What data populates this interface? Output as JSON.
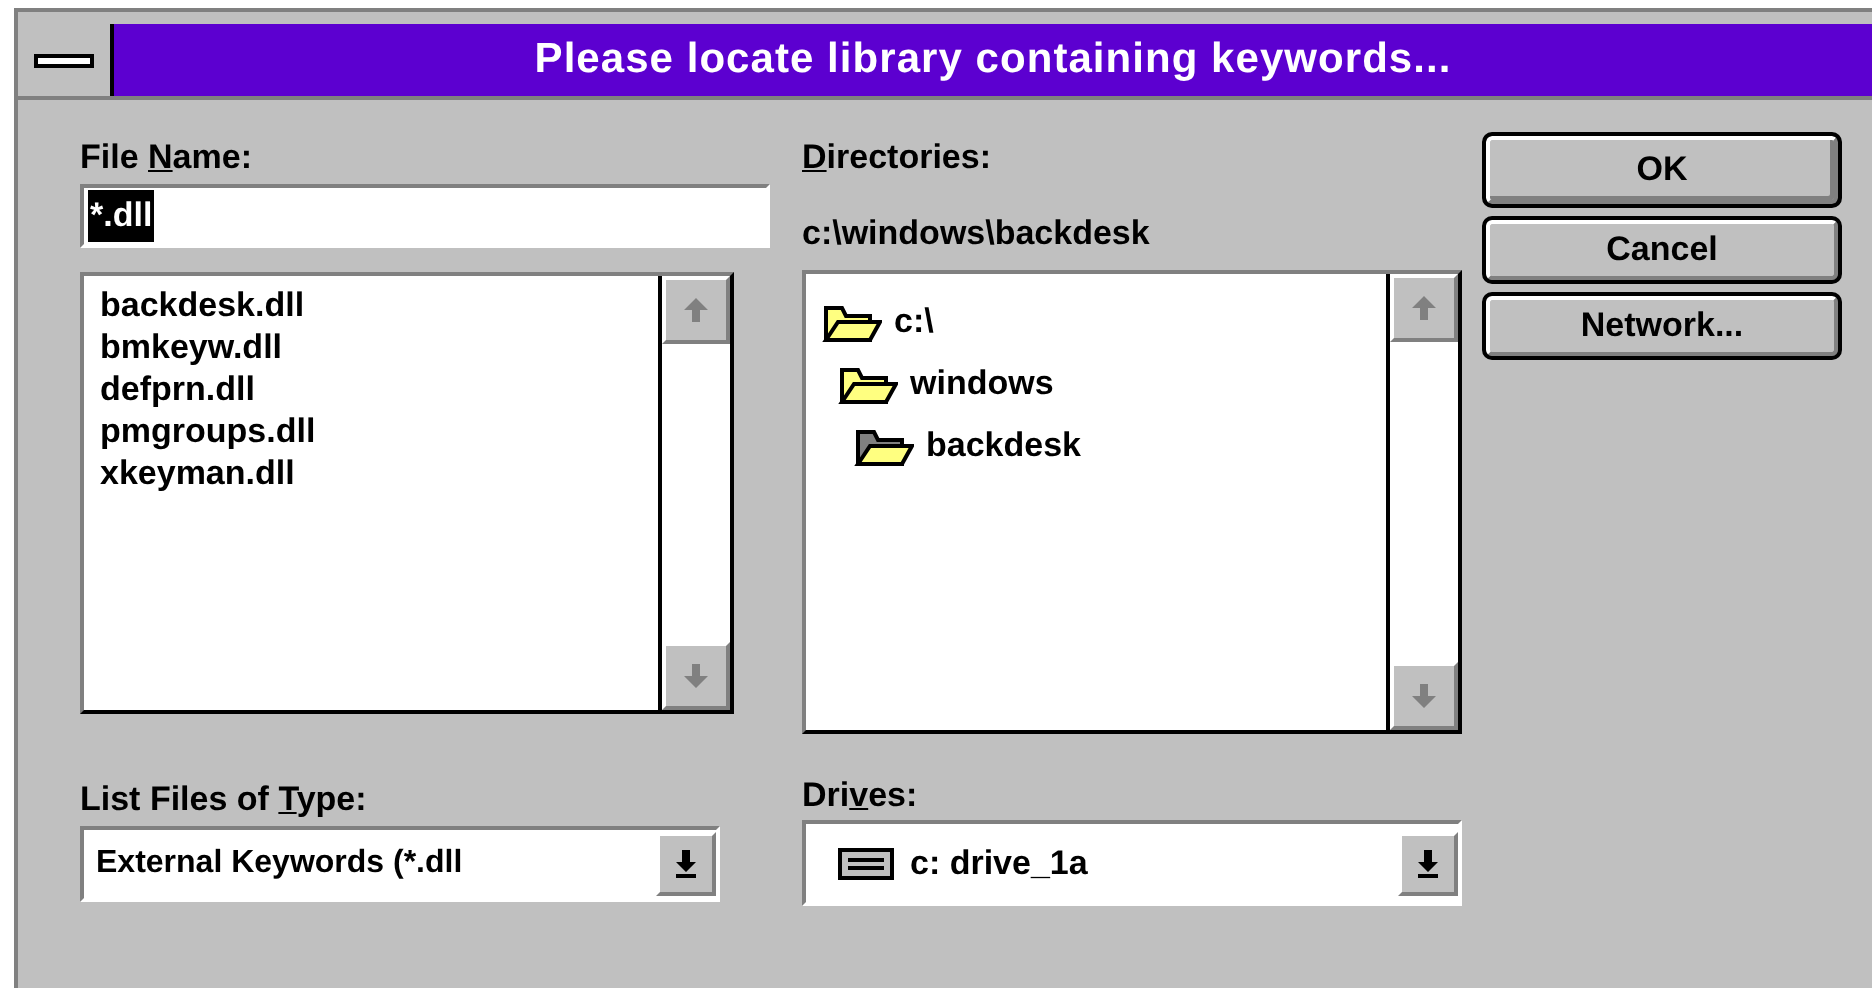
{
  "window": {
    "title": "Please locate library containing keywords..."
  },
  "file_name": {
    "label": {
      "before": "File ",
      "key": "N",
      "after": "ame:"
    },
    "value": "*.dll",
    "value_selected": true
  },
  "files": [
    {
      "name": "backdesk.dll"
    },
    {
      "name": "bmkeyw.dll"
    },
    {
      "name": "defprn.dll"
    },
    {
      "name": "pmgroups.dll"
    },
    {
      "name": "xkeyman.dll"
    }
  ],
  "directories": {
    "label": {
      "key": "D",
      "after": "irectories:"
    },
    "path": "c:\\windows\\backdesk",
    "tree": [
      {
        "name": "c:\\",
        "kind": "open",
        "children": [
          {
            "name": "windows",
            "kind": "open",
            "children": [
              {
                "name": "backdesk",
                "kind": "current"
              }
            ]
          }
        ]
      }
    ]
  },
  "file_type": {
    "label": {
      "before": "List Files of ",
      "key": "T",
      "after": "ype:"
    },
    "value": "External Keywords (*.dll"
  },
  "drives": {
    "label": {
      "before": "Dri",
      "key": "v",
      "after": "es:"
    },
    "value": "c: drive_1a"
  },
  "buttons": [
    {
      "label": "OK",
      "default": true
    },
    {
      "label": "Cancel",
      "default": false
    },
    {
      "label": "Network...",
      "default": false
    }
  ]
}
